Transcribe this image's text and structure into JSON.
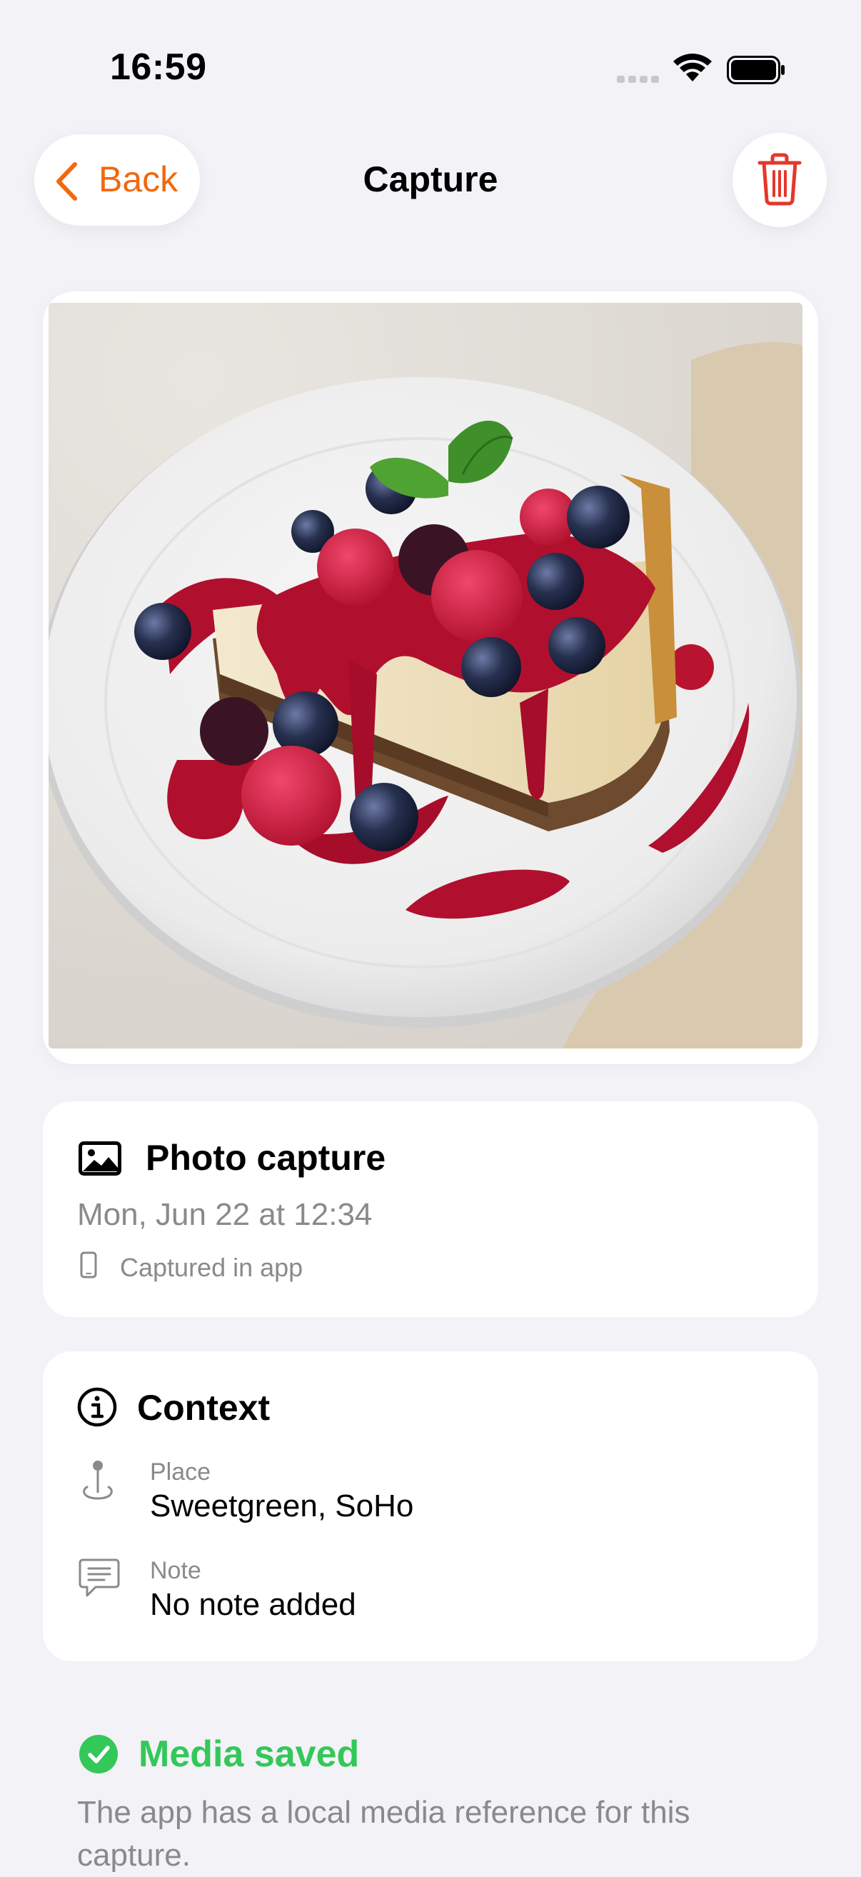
{
  "status_bar": {
    "time": "16:59"
  },
  "nav": {
    "back_label": "Back",
    "title": "Capture",
    "delete_icon": "trash-icon"
  },
  "photo": {
    "description_icon": "cheesecake-photo"
  },
  "capture": {
    "title": "Photo capture",
    "date": "Mon, Jun 22 at 12:34",
    "source": "Captured in app"
  },
  "context": {
    "title": "Context",
    "place_label": "Place",
    "place_value": "Sweetgreen, SoHo",
    "note_label": "Note",
    "note_value": "No note added"
  },
  "saved": {
    "title": "Media saved",
    "description": "The app has a local media reference for this capture."
  },
  "colors": {
    "accent": "#f2680d",
    "delete": "#e5372b",
    "success": "#34c759",
    "secondary_text": "#8a8a8e",
    "background": "#f2f2f7"
  }
}
